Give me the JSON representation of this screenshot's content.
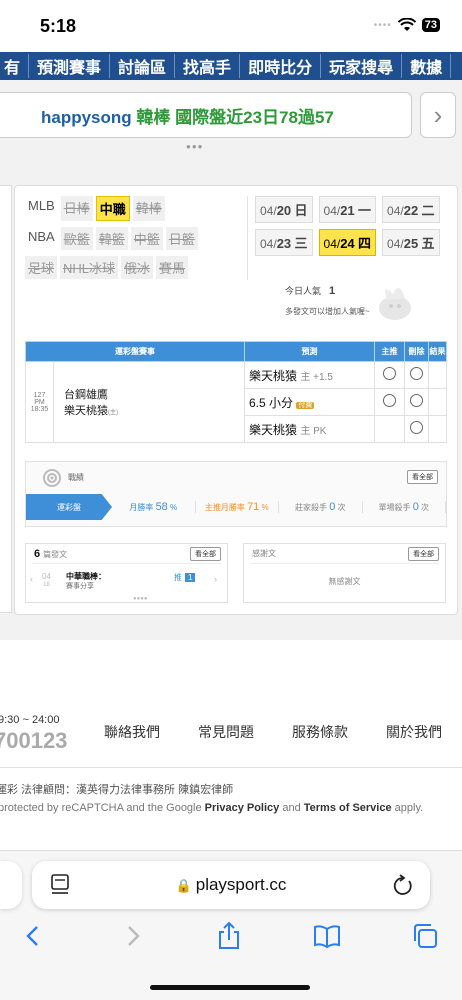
{
  "status": {
    "time": "5:18",
    "battery": "73"
  },
  "nav": {
    "items": [
      "有",
      "預測賽事",
      "討論區",
      "找高手",
      "即時比分",
      "玩家搜尋",
      "數據"
    ]
  },
  "banner": {
    "user": "happysong",
    "text": "韓棒 國際盤近23日78過57"
  },
  "sports": {
    "row1": [
      "MLB",
      "日棒",
      "中職",
      "韓棒"
    ],
    "row2": [
      "NBA",
      "歐籃",
      "韓籃",
      "中籃",
      "日籃"
    ],
    "row3": [
      "足球",
      "NHL冰球",
      "俄冰",
      "賽馬"
    ]
  },
  "dates": {
    "row1": [
      {
        "d": "04/",
        "n": "20",
        "w": "日"
      },
      {
        "d": "04/",
        "n": "21",
        "w": "一"
      },
      {
        "d": "04/",
        "n": "22",
        "w": "二"
      }
    ],
    "row2": [
      {
        "d": "04/",
        "n": "23",
        "w": "三"
      },
      {
        "d": "04/",
        "n": "24",
        "w": "四"
      },
      {
        "d": "04/",
        "n": "25",
        "w": "五"
      }
    ]
  },
  "popularity": {
    "label": "今日人氣",
    "value": "1",
    "hint": "多發文可以增加人氣喔~"
  },
  "games_table": {
    "headers": [
      "運彩盤賽事",
      "預測",
      "主推",
      "刪除",
      "結果"
    ],
    "game_no": "127",
    "game_time": "PM 18:35",
    "team_away": "台鋼雄鷹",
    "team_home": "樂天桃猿",
    "home_mark": "(主)",
    "picks": [
      {
        "main": "樂天桃猿",
        "sub": "主 +1.5"
      },
      {
        "main": "6.5 小分",
        "sub": "",
        "tag": "付費"
      },
      {
        "main": "樂天桃猿",
        "sub": "主 PK"
      }
    ]
  },
  "stats": {
    "title": "戰績",
    "view_all": "看全部",
    "tab": "運彩盤",
    "month_win": {
      "label": "月勝率",
      "value": "58",
      "unit": "%"
    },
    "main_month_win": {
      "label": "主推月勝率",
      "value": "71",
      "unit": "%"
    },
    "banker_killer": {
      "label": "莊家殺手",
      "value": "0",
      "unit": "次"
    },
    "single_killer": {
      "label": "單場殺手",
      "value": "0",
      "unit": "次"
    }
  },
  "posts": {
    "count": "6",
    "title": "篇發文",
    "view_all": "看全部",
    "item_month": "04",
    "item_day": "18",
    "item_title": "中華職棒：",
    "item_sub": "賽事分享",
    "push_label": "推",
    "push_count": "1"
  },
  "thanks": {
    "title": "感謝文",
    "view_all": "看全部",
    "empty": "無感謝文"
  },
  "footer": {
    "hours": "9:30 ~ 24:00",
    "phone": "700123",
    "links": [
      "聯絡我們",
      "常見問題",
      "服務條款",
      "關於我們"
    ],
    "legal": "運彩 法律顧問：漢英得力法律事務所 陳鎮宏律師",
    "recaptcha_pre": "protected by reCAPTCHA and the Google ",
    "privacy": "Privacy Policy",
    "and": " and ",
    "terms": "Terms of Service",
    "apply": " apply."
  },
  "browser": {
    "url": "playsport.cc"
  }
}
